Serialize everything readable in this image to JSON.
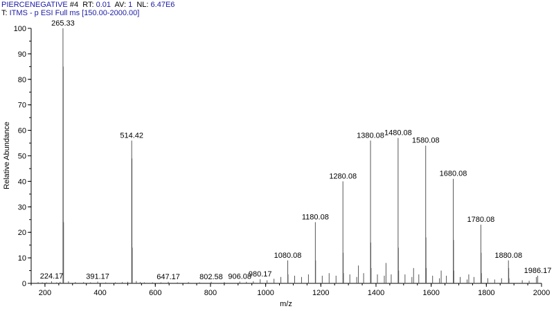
{
  "header": {
    "scan_name": "PIERCENEGATIVE",
    "scan_number": "#4",
    "rt_label": "RT:",
    "rt_value": "0.01",
    "av_label": "AV:",
    "av_value": "1",
    "nl_label": "NL:",
    "nl_value": "6.47E6",
    "filter_prefix": "T:",
    "filter_value": "ITMS - p ESI Full ms [150.00-2000.00]"
  },
  "colors": {
    "trace": "#555555",
    "axis": "#000000",
    "header_value": "#1a1aa6"
  },
  "chart_data": {
    "type": "line",
    "title": "",
    "xlabel": "m/z",
    "ylabel": "Relative Abundance",
    "xlim": [
      150,
      2000
    ],
    "ylim": [
      0,
      100
    ],
    "xticks": [
      200,
      400,
      600,
      800,
      1000,
      1200,
      1400,
      1600,
      1800,
      2000
    ],
    "yticks": [
      0,
      10,
      20,
      30,
      40,
      50,
      60,
      70,
      80,
      90,
      100
    ],
    "grid": false,
    "legend": "none",
    "peaks": [
      {
        "mz": 175.2,
        "rel": 0.5
      },
      {
        "mz": 190.5,
        "rel": 0.4
      },
      {
        "mz": 205.3,
        "rel": 0.4
      },
      {
        "mz": 224.17,
        "rel": 0.8,
        "label": "224.17"
      },
      {
        "mz": 242.3,
        "rel": 0.4
      },
      {
        "mz": 255.1,
        "rel": 0.6
      },
      {
        "mz": 265.33,
        "rel": 100,
        "label": "265.33"
      },
      {
        "mz": 266.3,
        "rel": 85
      },
      {
        "mz": 267.4,
        "rel": 24
      },
      {
        "mz": 285.2,
        "rel": 0.8
      },
      {
        "mz": 310.2,
        "rel": 0.5
      },
      {
        "mz": 340.1,
        "rel": 0.5
      },
      {
        "mz": 365.2,
        "rel": 0.4
      },
      {
        "mz": 391.17,
        "rel": 0.7,
        "label": "391.17"
      },
      {
        "mz": 420.3,
        "rel": 0.4
      },
      {
        "mz": 455.2,
        "rel": 0.4
      },
      {
        "mz": 480.1,
        "rel": 0.5
      },
      {
        "mz": 500.2,
        "rel": 0.6
      },
      {
        "mz": 514.42,
        "rel": 56,
        "label": "514.42"
      },
      {
        "mz": 515.4,
        "rel": 49
      },
      {
        "mz": 516.4,
        "rel": 14
      },
      {
        "mz": 531.2,
        "rel": 0.9
      },
      {
        "mz": 545.2,
        "rel": 0.5
      },
      {
        "mz": 560.3,
        "rel": 0.4
      },
      {
        "mz": 590.1,
        "rel": 0.4
      },
      {
        "mz": 620.2,
        "rel": 0.4
      },
      {
        "mz": 647.17,
        "rel": 0.6,
        "label": "647.17"
      },
      {
        "mz": 680.2,
        "rel": 0.4
      },
      {
        "mz": 720.2,
        "rel": 0.5
      },
      {
        "mz": 760.3,
        "rel": 0.4
      },
      {
        "mz": 802.58,
        "rel": 0.6,
        "label": "802.58"
      },
      {
        "mz": 850.1,
        "rel": 0.5
      },
      {
        "mz": 906.08,
        "rel": 0.7,
        "label": "906.08"
      },
      {
        "mz": 930.2,
        "rel": 0.6
      },
      {
        "mz": 955.2,
        "rel": 0.8
      },
      {
        "mz": 980.17,
        "rel": 1.6,
        "label": "980.17"
      },
      {
        "mz": 1005.1,
        "rel": 1.2
      },
      {
        "mz": 1030.2,
        "rel": 1.8
      },
      {
        "mz": 1055.1,
        "rel": 2.5
      },
      {
        "mz": 1080.08,
        "rel": 9,
        "label": "1080.08"
      },
      {
        "mz": 1081.1,
        "rel": 3.5
      },
      {
        "mz": 1105.1,
        "rel": 3.0
      },
      {
        "mz": 1130.1,
        "rel": 2.5
      },
      {
        "mz": 1155.1,
        "rel": 3.5
      },
      {
        "mz": 1180.08,
        "rel": 24,
        "label": "1180.08"
      },
      {
        "mz": 1181.1,
        "rel": 9
      },
      {
        "mz": 1205.1,
        "rel": 3.0
      },
      {
        "mz": 1230.1,
        "rel": 4.0
      },
      {
        "mz": 1255.1,
        "rel": 3.0
      },
      {
        "mz": 1280.08,
        "rel": 40,
        "label": "1280.08"
      },
      {
        "mz": 1281.1,
        "rel": 12
      },
      {
        "mz": 1282.1,
        "rel": 4
      },
      {
        "mz": 1305.1,
        "rel": 3.5
      },
      {
        "mz": 1330.1,
        "rel": 2.5
      },
      {
        "mz": 1336.2,
        "rel": 7
      },
      {
        "mz": 1355.1,
        "rel": 4
      },
      {
        "mz": 1380.08,
        "rel": 56,
        "label": "1380.08"
      },
      {
        "mz": 1381.1,
        "rel": 16
      },
      {
        "mz": 1382.1,
        "rel": 6
      },
      {
        "mz": 1405.1,
        "rel": 3.5
      },
      {
        "mz": 1430.1,
        "rel": 3
      },
      {
        "mz": 1436.2,
        "rel": 8
      },
      {
        "mz": 1455.1,
        "rel": 3.5
      },
      {
        "mz": 1480.08,
        "rel": 57,
        "label": "1480.08"
      },
      {
        "mz": 1481.1,
        "rel": 14
      },
      {
        "mz": 1482.1,
        "rel": 5
      },
      {
        "mz": 1505.1,
        "rel": 3.5
      },
      {
        "mz": 1530.1,
        "rel": 2.5
      },
      {
        "mz": 1536.2,
        "rel": 6
      },
      {
        "mz": 1555.1,
        "rel": 3.5
      },
      {
        "mz": 1580.08,
        "rel": 54,
        "label": "1580.08"
      },
      {
        "mz": 1581.1,
        "rel": 18
      },
      {
        "mz": 1582.1,
        "rel": 6
      },
      {
        "mz": 1605.1,
        "rel": 3
      },
      {
        "mz": 1630.1,
        "rel": 2
      },
      {
        "mz": 1636.2,
        "rel": 5
      },
      {
        "mz": 1655.1,
        "rel": 3
      },
      {
        "mz": 1680.08,
        "rel": 41,
        "label": "1680.08"
      },
      {
        "mz": 1681.1,
        "rel": 17
      },
      {
        "mz": 1682.1,
        "rel": 5
      },
      {
        "mz": 1705.1,
        "rel": 2.5
      },
      {
        "mz": 1730.1,
        "rel": 1.5
      },
      {
        "mz": 1736.2,
        "rel": 3.5
      },
      {
        "mz": 1755.1,
        "rel": 2.5
      },
      {
        "mz": 1780.08,
        "rel": 23,
        "label": "1780.08"
      },
      {
        "mz": 1781.1,
        "rel": 12
      },
      {
        "mz": 1782.1,
        "rel": 4
      },
      {
        "mz": 1805.1,
        "rel": 2
      },
      {
        "mz": 1830.1,
        "rel": 1.5
      },
      {
        "mz": 1855.1,
        "rel": 2
      },
      {
        "mz": 1880.08,
        "rel": 9,
        "label": "1880.08"
      },
      {
        "mz": 1881.1,
        "rel": 6
      },
      {
        "mz": 1882.1,
        "rel": 2
      },
      {
        "mz": 1930.1,
        "rel": 1.2
      },
      {
        "mz": 1955.1,
        "rel": 1
      },
      {
        "mz": 1986.17,
        "rel": 3,
        "label": "1986.17"
      },
      {
        "mz": 1981.1,
        "rel": 2.5
      }
    ]
  }
}
